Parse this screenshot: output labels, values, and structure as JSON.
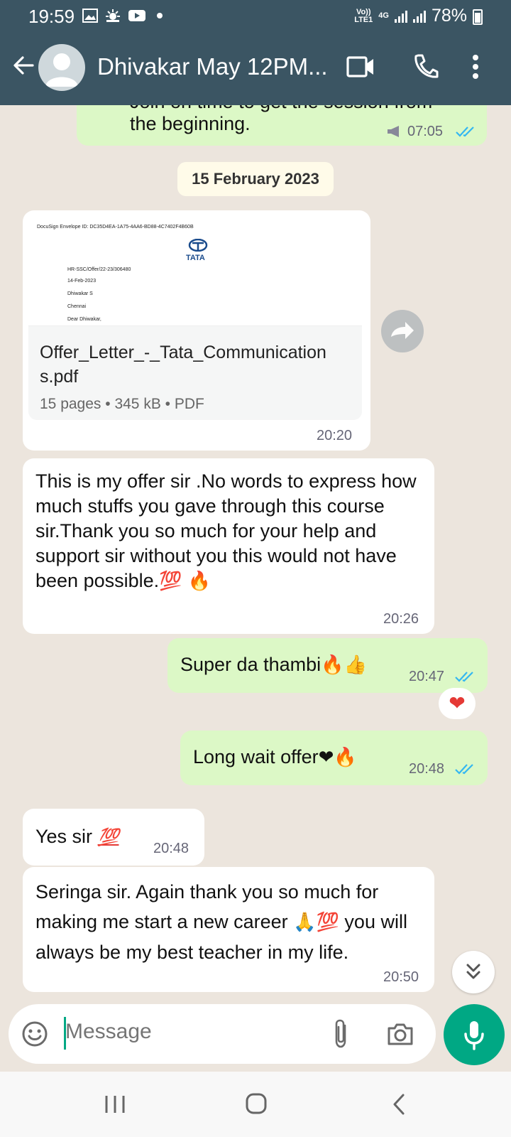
{
  "status_bar": {
    "time": "19:59",
    "network": "Vo)) LTE1",
    "net_gen": "4G",
    "battery": "78%"
  },
  "header": {
    "contact_name": "Dhivakar May 12PM..."
  },
  "chat": {
    "partial_message": {
      "text_line1": "Join on time to get the session from",
      "text_line2": "the beginning.",
      "time": "07:05"
    },
    "date_chip": "15 February 2023",
    "document": {
      "envelope_id": "DocuSign Envelope ID: DC35D4EA-1A75-4AA6-BD88-4C7402F4B60B",
      "logo_text": "TATA",
      "ref": "HR-SSC/Offer/22-23/306480",
      "date": "14-Feb-2023",
      "name": "Dhiwakar S",
      "city": "Chennai",
      "greeting": "Dear Dhiwakar,",
      "file_name": "Offer_Letter_-_Tata_Communications.pdf",
      "pages": "15 pages",
      "size": "345 kB",
      "type": "PDF",
      "time": "20:20"
    },
    "messages": [
      {
        "direction": "in",
        "text": "This is my offer sir .No words to express how much stuffs you gave through this course sir.Thank you so much for your help and support sir without you this would not have been possible.",
        "emojis": "💯 🔥",
        "time": "20:26"
      },
      {
        "direction": "out",
        "text": "Super da thambi",
        "emojis": "🔥👍",
        "time": "20:47",
        "reaction": "❤"
      },
      {
        "direction": "out",
        "text": "Long wait offer",
        "emojis": "❤🔥",
        "time": "20:48"
      },
      {
        "direction": "in",
        "text": "Yes sir",
        "emojis": "💯",
        "time": "20:48"
      },
      {
        "direction": "in",
        "text_part1": "Seringa sir. Again thank you so much for making me start a new career",
        "emojis": "🙏💯",
        "text_part2": "you will always be my best teacher in my life.",
        "time": "20:50"
      }
    ]
  },
  "composer": {
    "placeholder": "Message"
  },
  "colors": {
    "header": "#3b5563",
    "outgoing": "#dcf8c6",
    "incoming": "#ffffff",
    "accent": "#00a884",
    "tick": "#34b7f1"
  },
  "icons": [
    "back-arrow-icon",
    "video-call-icon",
    "phone-icon",
    "more-vert-icon",
    "share-icon",
    "scroll-down-icon",
    "emoji-icon",
    "attach-icon",
    "camera-icon",
    "mic-icon"
  ]
}
